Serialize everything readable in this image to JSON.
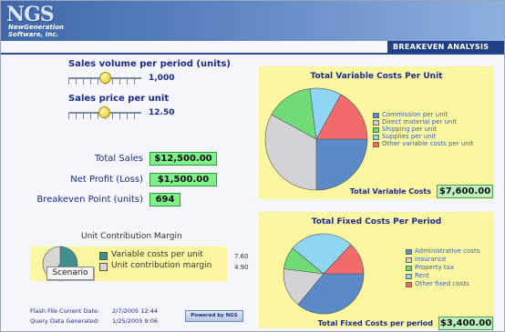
{
  "header": {
    "logo": "NGS",
    "logo_sub1": "NewGeneration",
    "logo_sub2": "Software, Inc.",
    "page_title": "BREAKEVEN ANALYSIS"
  },
  "inputs": {
    "sales_volume": {
      "label": "Sales volume per period (units)",
      "value": "1,000",
      "slider_fraction": 0.5
    },
    "sales_price": {
      "label": "Sales price per unit",
      "value": "12.50",
      "slider_fraction": 0.5
    }
  },
  "metrics": {
    "total_sales": {
      "label": "Total Sales",
      "value": "$12,500.00"
    },
    "net_profit": {
      "label": "Net Profit (Loss)",
      "value": "$1,500.00"
    },
    "breakeven": {
      "label": "Breakeven Point (units)",
      "value": "694"
    }
  },
  "variable_costs": {
    "title": "Total Variable Costs Per Unit",
    "legend": [
      {
        "label": "Commission per unit",
        "color": "#5b8ac9"
      },
      {
        "label": "Direct material per unit",
        "color": "#d3d3d6"
      },
      {
        "label": "Shipping per unit",
        "color": "#6fdc78"
      },
      {
        "label": "Supplies per unit",
        "color": "#8fd6f5"
      },
      {
        "label": "Other variable costs per unit",
        "color": "#f26b6b"
      }
    ],
    "total_label": "Total Variable Costs",
    "total_value": "$7,600.00"
  },
  "fixed_costs": {
    "title": "Total Fixed Costs Per Period",
    "legend": [
      {
        "label": "Administrative costs",
        "color": "#5b8ac9"
      },
      {
        "label": "Insurance",
        "color": "#d3d3d6"
      },
      {
        "label": "Property tax",
        "color": "#6fdc78"
      },
      {
        "label": "Rent",
        "color": "#8fd6f5"
      },
      {
        "label": "Other fixed costs",
        "color": "#f26b6b"
      }
    ],
    "total_label": "Total Fixed Costs per period",
    "total_value": "$3,400.00"
  },
  "unit_contribution": {
    "title": "Unit Contribution Margin",
    "rows": [
      {
        "label": "Variable costs per unit",
        "value": "7.60",
        "color": "#3f8f8f"
      },
      {
        "label": "Unit contribution margin",
        "value": "4.90",
        "color": "#d6d6d6"
      }
    ],
    "scenario_button": "Scenario"
  },
  "chart_data": [
    {
      "type": "pie",
      "title": "Total Variable Costs Per Unit",
      "categories": [
        "Commission per unit",
        "Direct material per unit",
        "Shipping per unit",
        "Supplies per unit",
        "Other variable costs per unit"
      ],
      "values": [
        25,
        33,
        15,
        10,
        17
      ],
      "colors": [
        "#5b8ac9",
        "#d3d3d6",
        "#6fdc78",
        "#8fd6f5",
        "#f26b6b"
      ]
    },
    {
      "type": "pie",
      "title": "Total Fixed Costs Per Period",
      "categories": [
        "Administrative costs",
        "Insurance",
        "Property tax",
        "Rent",
        "Other fixed costs"
      ],
      "values": [
        36,
        16,
        9,
        26,
        13
      ],
      "colors": [
        "#5b8ac9",
        "#d3d3d6",
        "#6fdc78",
        "#8fd6f5",
        "#f26b6b"
      ]
    },
    {
      "type": "pie",
      "title": "Unit Contribution Margin",
      "categories": [
        "Variable costs per unit",
        "Unit contribution margin"
      ],
      "values": [
        7.6,
        4.9
      ],
      "colors": [
        "#3f8f8f",
        "#d6d6d6"
      ]
    }
  ],
  "footer": {
    "flash_label": "Flash File Current Date:",
    "flash_value": "2/7/2005 12:44",
    "query_label": "Query Data Generated:",
    "query_value": "1/25/2005 9:06",
    "powered_button": "Powered by NGS"
  }
}
